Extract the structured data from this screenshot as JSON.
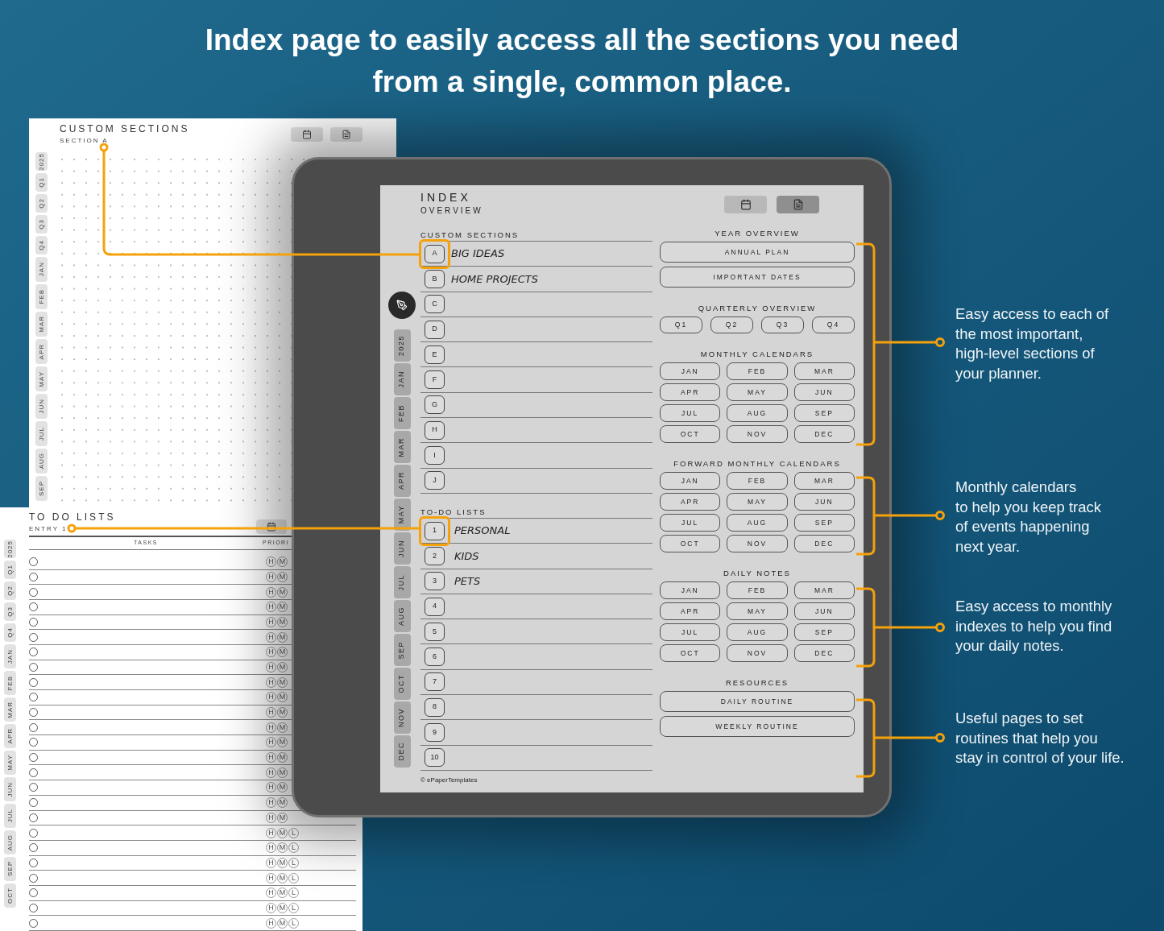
{
  "headline_lines": [
    "Index page to easily access all the sections you need",
    "from a single, common place."
  ],
  "sections_page": {
    "title": "CUSTOM SECTIONS",
    "subtitle": "SECTION A",
    "side_tabs": [
      "2025",
      "Q1",
      "Q2",
      "Q3",
      "Q4",
      "JAN",
      "FEB",
      "MAR",
      "APR",
      "MAY",
      "JUN",
      "JUL",
      "AUG",
      "SEP"
    ]
  },
  "todo_page": {
    "title": "TO DO LISTS",
    "subtitle": "ENTRY 1",
    "side_tabs": [
      "2025",
      "Q1",
      "Q2",
      "Q3",
      "Q4",
      "JAN",
      "FEB",
      "MAR",
      "APR",
      "MAY",
      "JUN",
      "JUL",
      "AUG",
      "SEP",
      "OCT"
    ],
    "columns": [
      "TASKS",
      "PRIORI"
    ],
    "rows": [
      {
        "checked": false,
        "priorities": [
          "H",
          "M"
        ]
      },
      {
        "checked": false,
        "priorities": [
          "H",
          "M"
        ]
      },
      {
        "checked": false,
        "priorities": [
          "H",
          "M"
        ]
      },
      {
        "checked": false,
        "priorities": [
          "H",
          "M"
        ]
      },
      {
        "checked": false,
        "priorities": [
          "H",
          "M"
        ]
      },
      {
        "checked": false,
        "priorities": [
          "H",
          "M"
        ]
      },
      {
        "checked": false,
        "priorities": [
          "H",
          "M"
        ]
      },
      {
        "checked": false,
        "priorities": [
          "H",
          "M"
        ]
      },
      {
        "checked": false,
        "priorities": [
          "H",
          "M"
        ]
      },
      {
        "checked": false,
        "priorities": [
          "H",
          "M"
        ]
      },
      {
        "checked": false,
        "priorities": [
          "H",
          "M"
        ]
      },
      {
        "checked": false,
        "priorities": [
          "H",
          "M"
        ]
      },
      {
        "checked": false,
        "priorities": [
          "H",
          "M"
        ]
      },
      {
        "checked": false,
        "priorities": [
          "H",
          "M"
        ]
      },
      {
        "checked": false,
        "priorities": [
          "H",
          "M"
        ]
      },
      {
        "checked": false,
        "priorities": [
          "H",
          "M"
        ]
      },
      {
        "checked": false,
        "priorities": [
          "H",
          "M"
        ]
      },
      {
        "checked": false,
        "priorities": [
          "H",
          "M"
        ]
      },
      {
        "checked": false,
        "priorities": [
          "H",
          "M",
          "L"
        ]
      },
      {
        "checked": false,
        "priorities": [
          "H",
          "M",
          "L"
        ]
      },
      {
        "checked": false,
        "priorities": [
          "H",
          "M",
          "L"
        ]
      },
      {
        "checked": false,
        "priorities": [
          "H",
          "M",
          "L"
        ]
      },
      {
        "checked": false,
        "priorities": [
          "H",
          "M",
          "L"
        ]
      },
      {
        "checked": false,
        "priorities": [
          "H",
          "M",
          "L"
        ]
      },
      {
        "checked": false,
        "priorities": [
          "H",
          "M",
          "L"
        ]
      }
    ]
  },
  "tablet": {
    "title": "INDEX",
    "subtitle": "OVERVIEW",
    "view_buttons": [
      {
        "kind": "calendar",
        "selected": false
      },
      {
        "kind": "list",
        "selected": true
      }
    ],
    "side_tabs": [
      "2025",
      "JAN",
      "FEB",
      "MAR",
      "APR",
      "MAY",
      "JUN",
      "JUL",
      "AUG",
      "SEP",
      "OCT",
      "NOV",
      "DEC"
    ],
    "lists": [
      {
        "heading": "CUSTOM SECTIONS",
        "rows": [
          {
            "key": "A",
            "label": "BIG IDEAS",
            "highlighted": true
          },
          {
            "key": "B",
            "label": "HOME PROJECTS",
            "highlighted": false
          },
          {
            "key": "C",
            "highlighted": false
          },
          {
            "key": "D",
            "highlighted": false
          },
          {
            "key": "E",
            "highlighted": false
          },
          {
            "key": "F",
            "highlighted": false
          },
          {
            "key": "G",
            "highlighted": false
          },
          {
            "key": "H",
            "highlighted": false
          },
          {
            "key": "I",
            "highlighted": false
          },
          {
            "key": "J",
            "highlighted": false
          }
        ]
      },
      {
        "heading": "TO-DO LISTS",
        "rows": [
          {
            "key": "1",
            "label": "PERSONAL",
            "highlighted": true
          },
          {
            "key": "2",
            "label": "KIDS",
            "highlighted": false
          },
          {
            "key": "3",
            "label": "PETS",
            "highlighted": false
          },
          {
            "key": "4",
            "highlighted": false
          },
          {
            "key": "5",
            "highlighted": false
          },
          {
            "key": "6",
            "highlighted": false
          },
          {
            "key": "7",
            "highlighted": false
          },
          {
            "key": "8",
            "highlighted": false
          },
          {
            "key": "9",
            "highlighted": false
          },
          {
            "key": "10",
            "highlighted": false
          }
        ]
      }
    ],
    "groups": [
      {
        "heading": "YEAR OVERVIEW",
        "kind": "wide",
        "buttons": [
          "ANNUAL PLAN",
          "IMPORTANT DATES"
        ]
      },
      {
        "heading": "QUARTERLY OVERVIEW",
        "kind": "quarters",
        "buttons": [
          "Q1",
          "Q2",
          "Q3",
          "Q4"
        ]
      },
      {
        "heading": "MONTHLY CALENDARS",
        "kind": "months",
        "buttons": [
          "JAN",
          "FEB",
          "MAR",
          "APR",
          "MAY",
          "JUN",
          "JUL",
          "AUG",
          "SEP",
          "OCT",
          "NOV",
          "DEC"
        ]
      },
      {
        "heading": "FORWARD MONTHLY CALENDARS",
        "kind": "months",
        "buttons": [
          "JAN",
          "FEB",
          "MAR",
          "APR",
          "MAY",
          "JUN",
          "JUL",
          "AUG",
          "SEP",
          "OCT",
          "NOV",
          "DEC"
        ]
      },
      {
        "heading": "DAILY NOTES",
        "kind": "months",
        "buttons": [
          "JAN",
          "FEB",
          "MAR",
          "APR",
          "MAY",
          "JUN",
          "JUL",
          "AUG",
          "SEP",
          "OCT",
          "NOV",
          "DEC"
        ]
      },
      {
        "heading": "RESOURCES",
        "kind": "wide",
        "buttons": [
          "DAILY ROUTINE",
          "WEEKLY ROUTINE"
        ]
      }
    ],
    "footer": "© ePaperTemplates"
  },
  "callouts": [
    {
      "lines": [
        "Easy access to each of",
        "the most important,",
        "high-level sections of",
        "your planner."
      ]
    },
    {
      "lines": [
        "Monthly calendars",
        "to help you keep track",
        "of events happening",
        "next year."
      ]
    },
    {
      "lines": [
        "Easy access to monthly",
        "indexes to help you find",
        "your daily notes."
      ]
    },
    {
      "lines": [
        "Useful pages to set",
        "routines that help you",
        "stay in control of your life."
      ]
    }
  ]
}
